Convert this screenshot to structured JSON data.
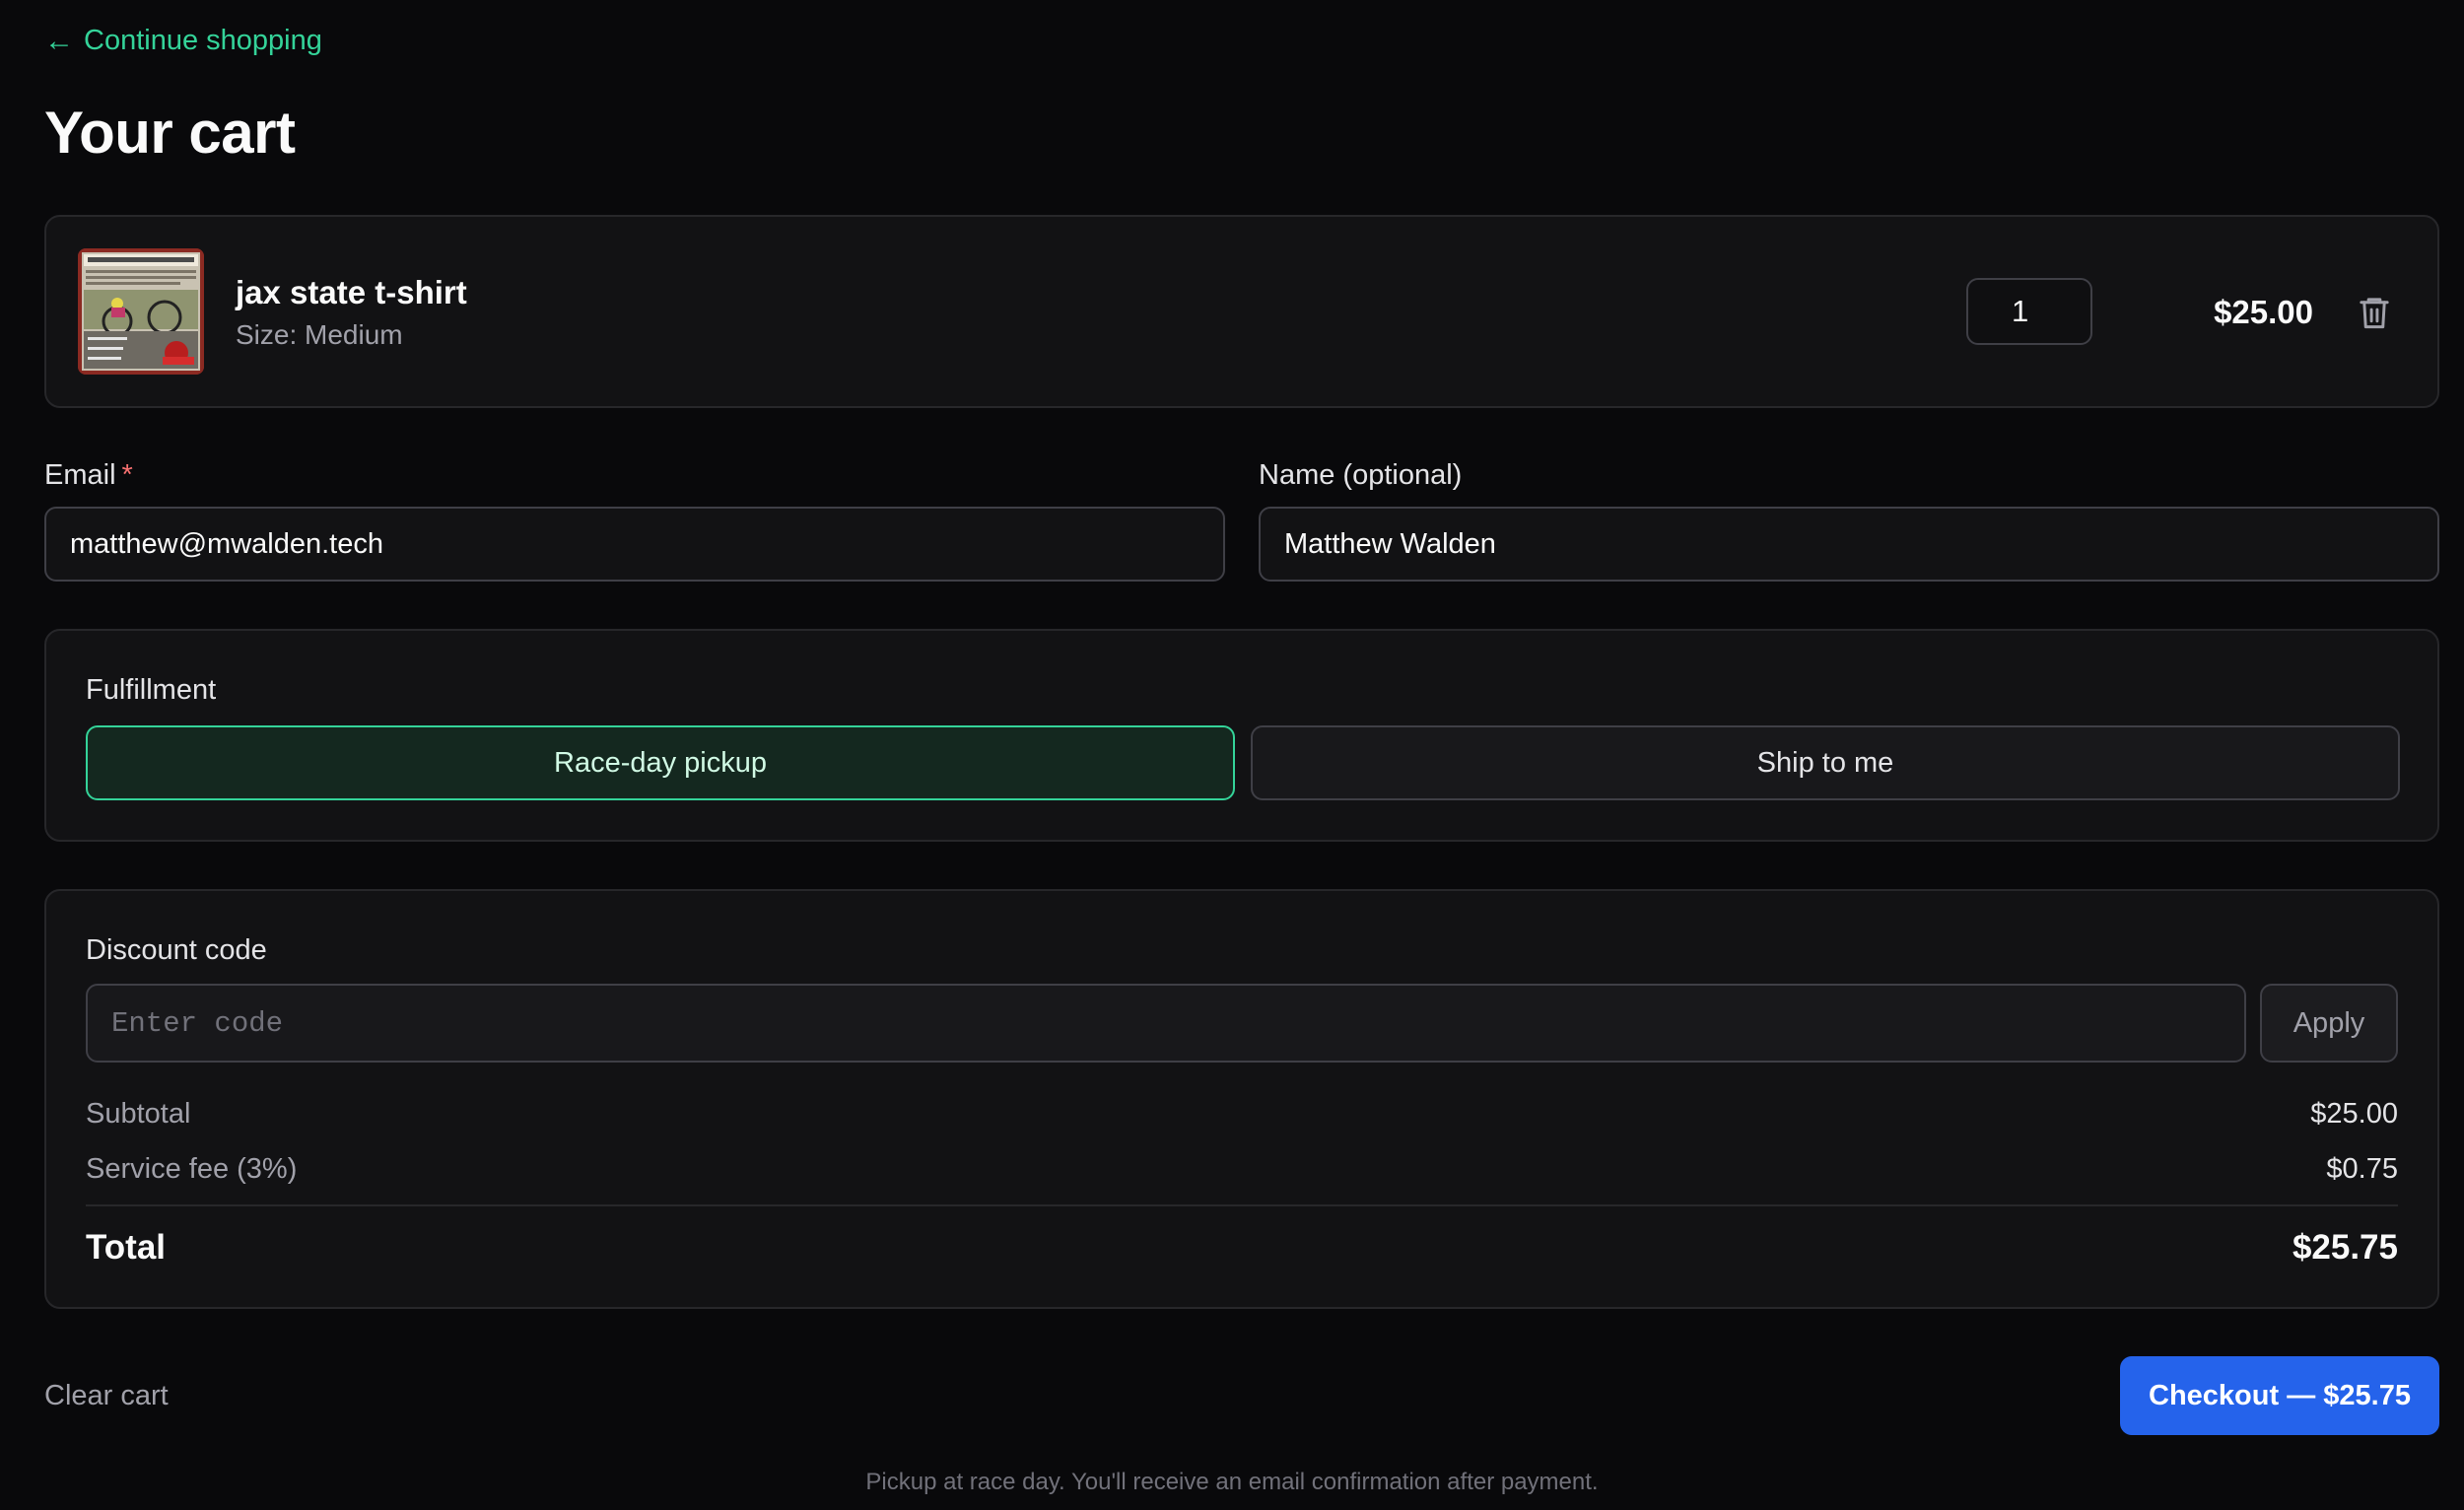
{
  "nav": {
    "back_label": "Continue shopping"
  },
  "page": {
    "title": "Your cart"
  },
  "cart": {
    "items": [
      {
        "name": "jax state t-shirt",
        "size": "Size: Medium",
        "quantity": "1",
        "price": "$25.00"
      }
    ]
  },
  "form": {
    "email": {
      "label": "Email",
      "required_mark": "*",
      "value": "matthew@mwalden.tech"
    },
    "name": {
      "label": "Name (optional)",
      "value": "Matthew Walden"
    }
  },
  "fulfillment": {
    "label": "Fulfillment",
    "options": [
      {
        "label": "Race-day pickup",
        "selected": true
      },
      {
        "label": "Ship to me",
        "selected": false
      }
    ]
  },
  "discount": {
    "label": "Discount code",
    "placeholder": "Enter code",
    "apply_label": "Apply"
  },
  "summary": {
    "subtotal_label": "Subtotal",
    "subtotal": "$25.00",
    "fee_label": "Service fee (3%)",
    "fee": "$0.75",
    "total_label": "Total",
    "total": "$25.75"
  },
  "actions": {
    "clear_label": "Clear cart",
    "checkout_label": "Checkout — $25.75"
  },
  "footer": {
    "note": "Pickup at race day. You'll receive an email confirmation after payment."
  },
  "colors": {
    "accent": "#34d399",
    "primary": "#2563eb",
    "background": "#09090b",
    "danger": "#f87171"
  }
}
